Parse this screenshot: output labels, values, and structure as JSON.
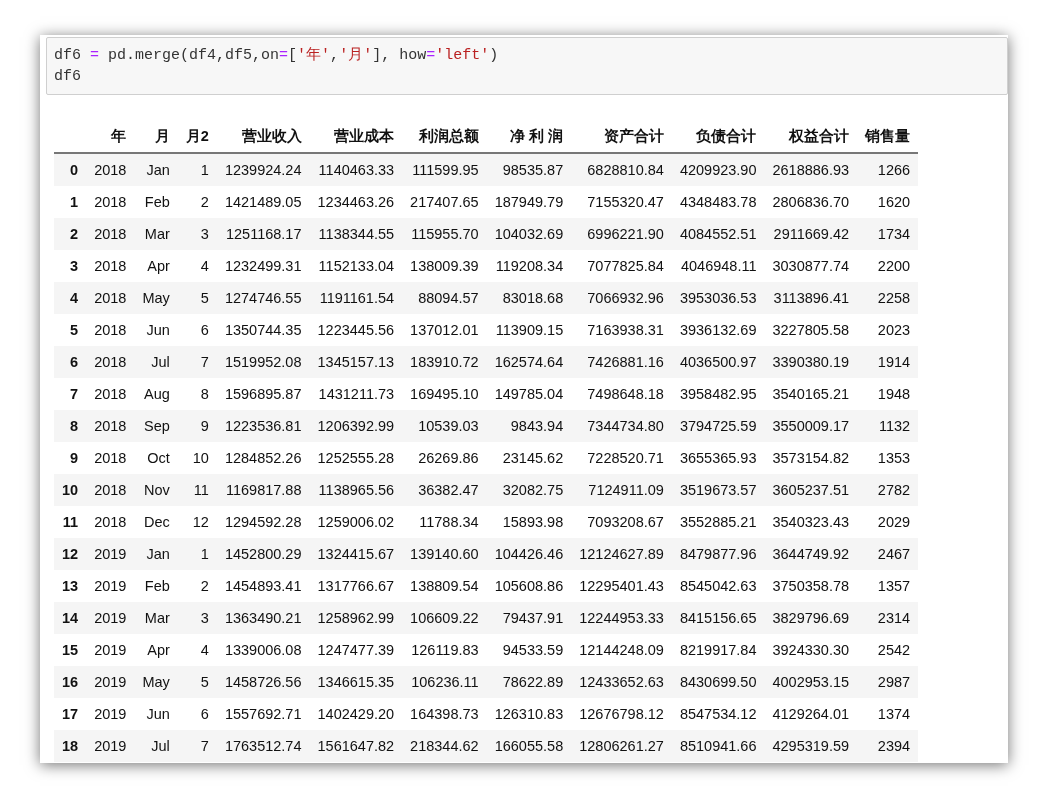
{
  "code_cell": {
    "lines": [
      [
        {
          "kind": "plain",
          "text": "df6 "
        },
        {
          "kind": "op",
          "text": "="
        },
        {
          "kind": "plain",
          "text": " pd.merge(df4,df5,on"
        },
        {
          "kind": "op",
          "text": "="
        },
        {
          "kind": "plain",
          "text": "["
        },
        {
          "kind": "string",
          "text": "'年'"
        },
        {
          "kind": "plain",
          "text": ","
        },
        {
          "kind": "string",
          "text": "'月'"
        },
        {
          "kind": "plain",
          "text": "], how"
        },
        {
          "kind": "op",
          "text": "="
        },
        {
          "kind": "string",
          "text": "'left'"
        },
        {
          "kind": "plain",
          "text": ")"
        }
      ],
      [
        {
          "kind": "plain",
          "text": "df6"
        }
      ]
    ]
  },
  "table": {
    "columns": [
      "年",
      "月",
      "月2",
      "营业收入",
      "营业成本",
      "利润总额",
      "净 利 润",
      "资产合计",
      "负债合计",
      "权益合计",
      "销售量"
    ],
    "rows": [
      {
        "index": "0",
        "cells": [
          "2018",
          "Jan",
          "1",
          "1239924.24",
          "1140463.33",
          "111599.95",
          "98535.87",
          "6828810.84",
          "4209923.90",
          "2618886.93",
          "1266"
        ]
      },
      {
        "index": "1",
        "cells": [
          "2018",
          "Feb",
          "2",
          "1421489.05",
          "1234463.26",
          "217407.65",
          "187949.79",
          "7155320.47",
          "4348483.78",
          "2806836.70",
          "1620"
        ]
      },
      {
        "index": "2",
        "cells": [
          "2018",
          "Mar",
          "3",
          "1251168.17",
          "1138344.55",
          "115955.70",
          "104032.69",
          "6996221.90",
          "4084552.51",
          "2911669.42",
          "1734"
        ]
      },
      {
        "index": "3",
        "cells": [
          "2018",
          "Apr",
          "4",
          "1232499.31",
          "1152133.04",
          "138009.39",
          "119208.34",
          "7077825.84",
          "4046948.11",
          "3030877.74",
          "2200"
        ]
      },
      {
        "index": "4",
        "cells": [
          "2018",
          "May",
          "5",
          "1274746.55",
          "1191161.54",
          "88094.57",
          "83018.68",
          "7066932.96",
          "3953036.53",
          "3113896.41",
          "2258"
        ]
      },
      {
        "index": "5",
        "cells": [
          "2018",
          "Jun",
          "6",
          "1350744.35",
          "1223445.56",
          "137012.01",
          "113909.15",
          "7163938.31",
          "3936132.69",
          "3227805.58",
          "2023"
        ]
      },
      {
        "index": "6",
        "cells": [
          "2018",
          "Jul",
          "7",
          "1519952.08",
          "1345157.13",
          "183910.72",
          "162574.64",
          "7426881.16",
          "4036500.97",
          "3390380.19",
          "1914"
        ]
      },
      {
        "index": "7",
        "cells": [
          "2018",
          "Aug",
          "8",
          "1596895.87",
          "1431211.73",
          "169495.10",
          "149785.04",
          "7498648.18",
          "3958482.95",
          "3540165.21",
          "1948"
        ]
      },
      {
        "index": "8",
        "cells": [
          "2018",
          "Sep",
          "9",
          "1223536.81",
          "1206392.99",
          "10539.03",
          "9843.94",
          "7344734.80",
          "3794725.59",
          "3550009.17",
          "1132"
        ]
      },
      {
        "index": "9",
        "cells": [
          "2018",
          "Oct",
          "10",
          "1284852.26",
          "1252555.28",
          "26269.86",
          "23145.62",
          "7228520.71",
          "3655365.93",
          "3573154.82",
          "1353"
        ]
      },
      {
        "index": "10",
        "cells": [
          "2018",
          "Nov",
          "11",
          "1169817.88",
          "1138965.56",
          "36382.47",
          "32082.75",
          "7124911.09",
          "3519673.57",
          "3605237.51",
          "2782"
        ]
      },
      {
        "index": "11",
        "cells": [
          "2018",
          "Dec",
          "12",
          "1294592.28",
          "1259006.02",
          "11788.34",
          "15893.98",
          "7093208.67",
          "3552885.21",
          "3540323.43",
          "2029"
        ]
      },
      {
        "index": "12",
        "cells": [
          "2019",
          "Jan",
          "1",
          "1452800.29",
          "1324415.67",
          "139140.60",
          "104426.46",
          "12124627.89",
          "8479877.96",
          "3644749.92",
          "2467"
        ]
      },
      {
        "index": "13",
        "cells": [
          "2019",
          "Feb",
          "2",
          "1454893.41",
          "1317766.67",
          "138809.54",
          "105608.86",
          "12295401.43",
          "8545042.63",
          "3750358.78",
          "1357"
        ]
      },
      {
        "index": "14",
        "cells": [
          "2019",
          "Mar",
          "3",
          "1363490.21",
          "1258962.99",
          "106609.22",
          "79437.91",
          "12244953.33",
          "8415156.65",
          "3829796.69",
          "2314"
        ]
      },
      {
        "index": "15",
        "cells": [
          "2019",
          "Apr",
          "4",
          "1339006.08",
          "1247477.39",
          "126119.83",
          "94533.59",
          "12144248.09",
          "8219917.84",
          "3924330.30",
          "2542"
        ]
      },
      {
        "index": "16",
        "cells": [
          "2019",
          "May",
          "5",
          "1458726.56",
          "1346615.35",
          "106236.11",
          "78622.89",
          "12433652.63",
          "8430699.50",
          "4002953.15",
          "2987"
        ]
      },
      {
        "index": "17",
        "cells": [
          "2019",
          "Jun",
          "6",
          "1557692.71",
          "1402429.20",
          "164398.73",
          "126310.83",
          "12676798.12",
          "8547534.12",
          "4129264.01",
          "1374"
        ]
      },
      {
        "index": "18",
        "cells": [
          "2019",
          "Jul",
          "7",
          "1763512.74",
          "1561647.82",
          "218344.62",
          "166055.58",
          "12806261.27",
          "8510941.66",
          "4295319.59",
          "2394"
        ]
      }
    ]
  }
}
